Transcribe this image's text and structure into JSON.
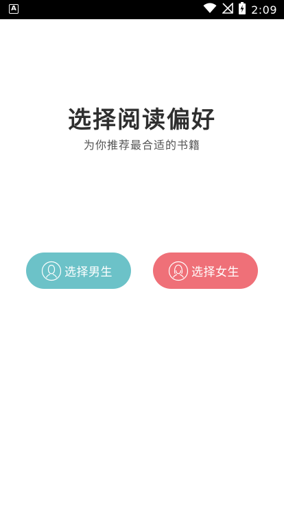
{
  "status_bar": {
    "app_indicator": "A",
    "time": "2:09"
  },
  "main": {
    "title": "选择阅读偏好",
    "subtitle": "为你推荐最合适的书籍"
  },
  "choices": {
    "male_label": "选择男生",
    "female_label": "选择女生"
  },
  "colors": {
    "male_button": "#6cc2c8",
    "female_button": "#ef7078",
    "title": "#2f2f2f",
    "subtitle": "#555555"
  },
  "icons": {
    "male": "male-avatar-icon",
    "female": "female-avatar-icon",
    "wifi": "wifi-icon",
    "signal": "no-signal-icon",
    "battery": "battery-charging-icon"
  }
}
